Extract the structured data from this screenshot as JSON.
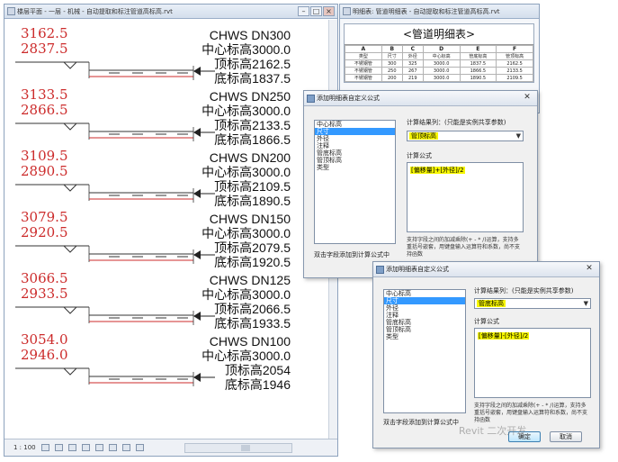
{
  "plan_window": {
    "title": "楼层平面 - 一层 - 机械 - 自动提取和标注管道高标高.rvt",
    "status": {
      "scale": "1 : 100"
    }
  },
  "pipes": [
    {
      "top_elev": "3162.5",
      "bottom_elev": "2837.5",
      "name": "CHWS DN300",
      "center": "中心标高3000.0",
      "top": "顶标高2162.5",
      "bottom": "底标高1837.5"
    },
    {
      "top_elev": "3133.5",
      "bottom_elev": "2866.5",
      "name": "CHWS DN250",
      "center": "中心标高3000.0",
      "top": "顶标高2133.5",
      "bottom": "底标高1866.5"
    },
    {
      "top_elev": "3109.5",
      "bottom_elev": "2890.5",
      "name": "CHWS DN200",
      "center": "中心标高3000.0",
      "top": "顶标高2109.5",
      "bottom": "底标高1890.5"
    },
    {
      "top_elev": "3079.5",
      "bottom_elev": "2920.5",
      "name": "CHWS DN150",
      "center": "中心标高3000.0",
      "top": "顶标高2079.5",
      "bottom": "底标高1920.5"
    },
    {
      "top_elev": "3066.5",
      "bottom_elev": "2933.5",
      "name": "CHWS DN125",
      "center": "中心标高3000.0",
      "top": "顶标高2066.5",
      "bottom": "底标高1933.5"
    },
    {
      "top_elev": "3054.0",
      "bottom_elev": "2946.0",
      "name": "CHWS DN100",
      "center": "中心标高3000.0",
      "top": "顶标高2054",
      "bottom": "底标高1946"
    }
  ],
  "schedule": {
    "window_title": "明细表: 管道明细表 - 自动提取和标注管道高标高.rvt",
    "heading": "<管道明细表>",
    "letters": [
      "A",
      "B",
      "C",
      "D",
      "E",
      "F"
    ],
    "columns": [
      "类型",
      "尺寸",
      "外径",
      "中心标高",
      "管底标高",
      "管顶标高"
    ],
    "rows": [
      [
        "不锈钢管",
        "300",
        "325",
        "3000.0",
        "1837.5",
        "2162.5"
      ],
      [
        "不锈钢管",
        "250",
        "267",
        "3000.0",
        "1866.5",
        "2133.5"
      ],
      [
        "不锈钢管",
        "200",
        "219",
        "3000.0",
        "1890.5",
        "2109.5"
      ]
    ]
  },
  "dialog1": {
    "title": "添加明细表自定义公式",
    "params": [
      "中心标高",
      "尺寸",
      "外径",
      "注释",
      "管底标高",
      "管顶标高",
      "类型"
    ],
    "selected_index": 1,
    "sample_label": "计算结果列：(只能是实例共享参数)",
    "sample_value": "管顶标高",
    "formula_label": "计算公式",
    "formula": "[偏移量]+[外径]/2",
    "hint": "支持字段之间的加减乘除(+ - * /)运算，支持多重括号嵌套，用键盘输入运算符和系数，尚不支持函数",
    "footer": "双击字段添加到计算公式中"
  },
  "dialog2": {
    "title": "添加明细表自定义公式",
    "params": [
      "中心标高",
      "尺寸",
      "外径",
      "注释",
      "管底标高",
      "管顶标高",
      "类型"
    ],
    "selected_index": 1,
    "sample_label": "计算结果列：(只能是实例共享参数)",
    "sample_value": "管底标高",
    "formula_label": "计算公式",
    "formula": "[偏移量]-[外径]/2",
    "hint": "支持字段之间的加减乘除(+ - * /)运算，支持多重括号嵌套，用键盘输入运算符和系数，尚不支持函数",
    "footer": "双击字段添加到计算公式中",
    "ok": "确定",
    "cancel": "取消"
  },
  "watermark": "Revit 二次开发"
}
